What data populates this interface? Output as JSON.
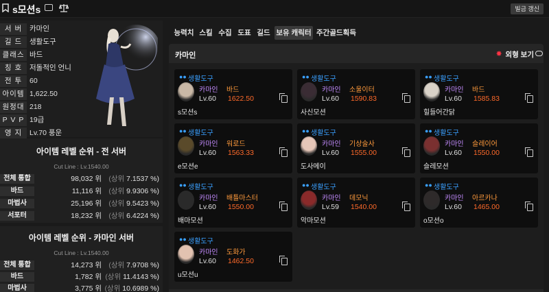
{
  "topbar": {
    "character_name": "s모션s",
    "refresh_label": "빌금 갱신"
  },
  "profile": {
    "rows": [
      {
        "label": "서 버",
        "value": "카마인"
      },
      {
        "label": "길 드",
        "value": "생활도구"
      },
      {
        "label": "클래스",
        "value": "바드"
      },
      {
        "label": "칭 호",
        "value": "저돌적인 언니"
      },
      {
        "label": "전 투",
        "value": "60"
      },
      {
        "label": "아이템",
        "value": "1,622.50"
      },
      {
        "label": "원정대",
        "value": "218"
      },
      {
        "label": "P V P",
        "value": "19급"
      },
      {
        "label": "영 지",
        "value": "Lv.70 풍운"
      }
    ]
  },
  "ranking_all": {
    "title": "아이템 레벨 순위 - 전 서버",
    "cutline": "Cut Line : Lv.1540.00",
    "rows": [
      {
        "label": "전체 통합",
        "rank": "98,032 위",
        "muted": "(상위",
        "pct": "7.1537 %)"
      },
      {
        "label": "바드",
        "rank": "11,116 위",
        "muted": "(상위",
        "pct": "9.9306 %)"
      },
      {
        "label": "마법사",
        "rank": "25,196 위",
        "muted": "(상위",
        "pct": "9.5423 %)"
      },
      {
        "label": "서포터",
        "rank": "18,232 위",
        "muted": "(상위",
        "pct": "6.4224 %)"
      }
    ]
  },
  "ranking_server": {
    "title": "아이템 레벨 순위 - 카마인 서버",
    "cutline": "Cut Line : Lv.1540.00",
    "rows": [
      {
        "label": "전체 통합",
        "rank": "14,273 위",
        "muted": "(상위",
        "pct": "7.9708 %)"
      },
      {
        "label": "바드",
        "rank": "1,782 위",
        "muted": "(상위",
        "pct": "11.4143 %)"
      },
      {
        "label": "마법사",
        "rank": "3,775 위",
        "muted": "(상위",
        "pct": "10.6989 %)"
      }
    ]
  },
  "tabs": [
    {
      "label": "능력치"
    },
    {
      "label": "스킬"
    },
    {
      "label": "수집"
    },
    {
      "label": "도표"
    },
    {
      "label": "길드"
    },
    {
      "label": "보유 캐릭터",
      "active": true
    },
    {
      "label": "주간골드획득"
    }
  ],
  "roster": {
    "server_title": "카마인",
    "look_label": "외형 보기",
    "cards": [
      {
        "guild": "생활도구",
        "server": "카마인",
        "class": "바드",
        "level": "Lv.60",
        "ilvl": "1622.50",
        "name": "s모션s",
        "avatar_color": "#c9b8a6"
      },
      {
        "guild": "생활도구",
        "server": "카마인",
        "class": "소울이터",
        "level": "Lv.60",
        "ilvl": "1590.83",
        "name": "사신모션",
        "avatar_color": "#3a2c34"
      },
      {
        "guild": "생활도구",
        "server": "카마인",
        "class": "바드",
        "level": "Lv.60",
        "ilvl": "1585.83",
        "name": "힐들어간닭",
        "avatar_color": "#d9d2c8"
      },
      {
        "guild": "생활도구",
        "server": "카마인",
        "class": "워로드",
        "level": "Lv.60",
        "ilvl": "1563.33",
        "name": "e모션e",
        "avatar_color": "#5a4a2a"
      },
      {
        "guild": "생활도구",
        "server": "카마인",
        "class": "기상술사",
        "level": "Lv.60",
        "ilvl": "1555.00",
        "name": "도사메이",
        "avatar_color": "#e6c6b8"
      },
      {
        "guild": "생활도구",
        "server": "카마인",
        "class": "슬레이어",
        "level": "Lv.60",
        "ilvl": "1550.00",
        "name": "슬레모션",
        "avatar_color": "#7a3030"
      },
      {
        "guild": "생활도구",
        "server": "카마인",
        "class": "배틀마스터",
        "level": "Lv.60",
        "ilvl": "1550.00",
        "name": "배마모션",
        "avatar_color": "#2a2a2a"
      },
      {
        "guild": "생활도구",
        "server": "카마인",
        "class": "데모닉",
        "level": "Lv.59",
        "ilvl": "1540.00",
        "name": "악마모션",
        "avatar_color": "#8a2a2a"
      },
      {
        "guild": "생활도구",
        "server": "카마인",
        "class": "아르카나",
        "level": "Lv.60",
        "ilvl": "1465.00",
        "name": "o모션o",
        "avatar_color": "#2e2a2a"
      },
      {
        "guild": "생활도구",
        "server": "카마인",
        "class": "도화가",
        "level": "Lv.60",
        "ilvl": "1462.50",
        "name": "u모션u",
        "avatar_color": "#e2c2b0"
      }
    ]
  }
}
